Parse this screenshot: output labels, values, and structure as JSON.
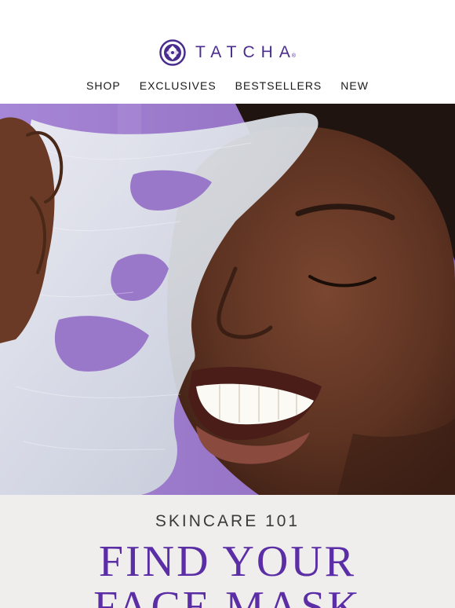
{
  "brand": {
    "name": "TATCHA",
    "registered": "®",
    "color": "#4a2c8f"
  },
  "nav": {
    "items": [
      {
        "label": "SHOP"
      },
      {
        "label": "EXCLUSIVES"
      },
      {
        "label": "BESTSELLERS"
      },
      {
        "label": "NEW"
      }
    ]
  },
  "hero": {
    "background_color": "#9b7ac9",
    "subject": "hero-photo"
  },
  "promo": {
    "eyebrow": "SKINCARE 101",
    "headline_line1": "FIND YOUR",
    "headline_line2": "FACE MASK",
    "headline_color": "#5b2ea6"
  }
}
